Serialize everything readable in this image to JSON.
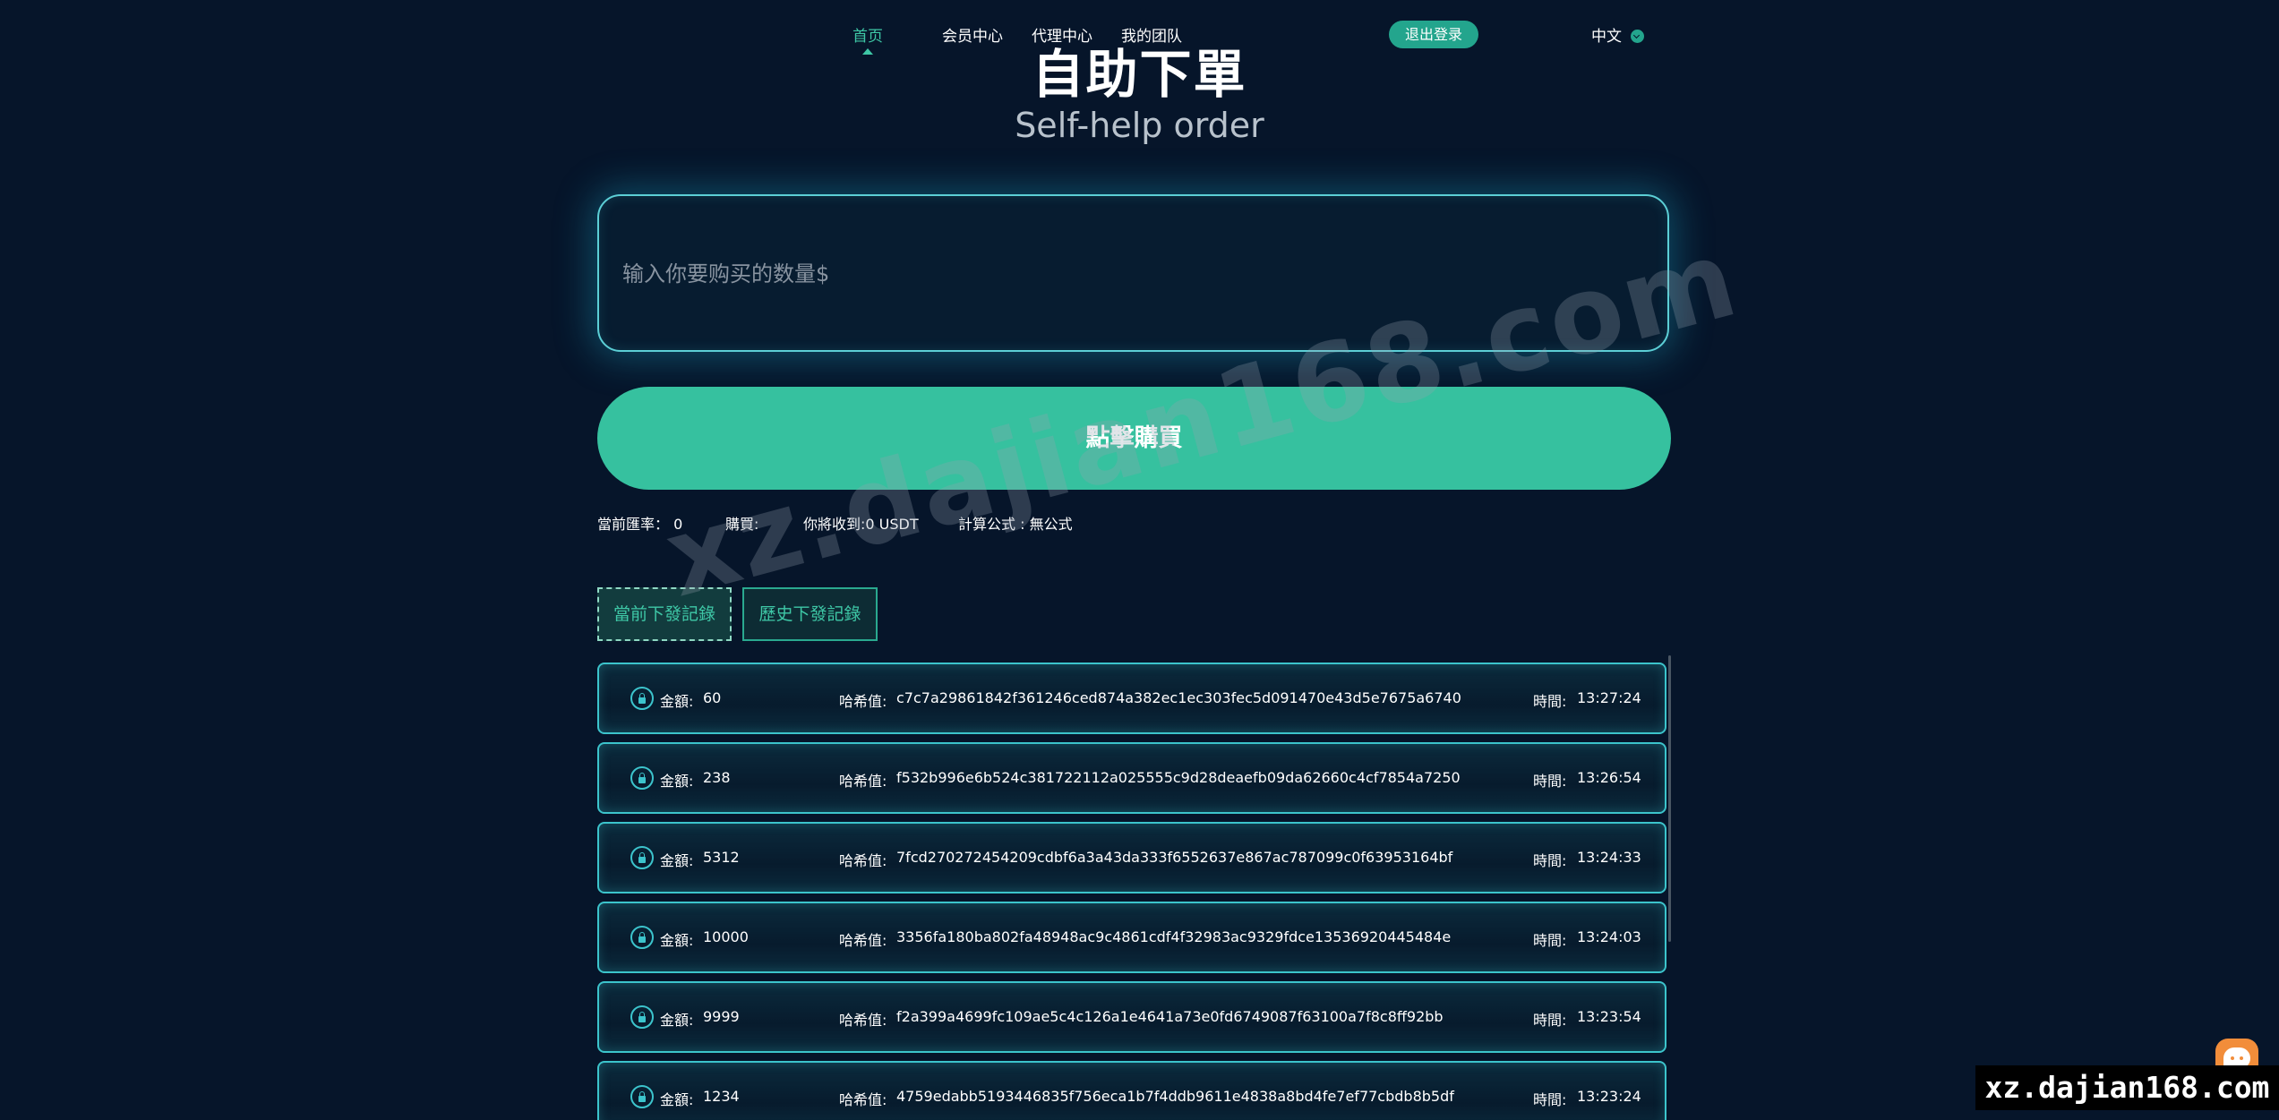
{
  "nav": {
    "home": "首页",
    "member": "会员中心",
    "agent": "代理中心",
    "team": "我的团队",
    "logout": "退出登录",
    "language": "中文"
  },
  "hero": {
    "title": "自助下單",
    "subtitle": "Self-help order"
  },
  "form": {
    "amount_placeholder": "输入你要购买的数量$",
    "buy_button": "點擊購買"
  },
  "info": {
    "rate": "當前匯率： 0",
    "purchase": "購買:",
    "receive": "你將收到:0 USDT",
    "formula": "計算公式 : 無公式"
  },
  "tabs": {
    "current": "當前下發記錄",
    "history": "歷史下發記錄"
  },
  "records": [
    {
      "amount_label": "金額:",
      "amount": "60",
      "hash_label": "哈希值:",
      "hash": "c7c7a29861842f361246ced874a382ec1ec303fec5d091470e43d5e7675a6740",
      "time_label": "時間:",
      "time": "13:27:24"
    },
    {
      "amount_label": "金額:",
      "amount": "238",
      "hash_label": "哈希值:",
      "hash": "f532b996e6b524c381722112a025555c9d28deaefb09da62660c4cf7854a7250",
      "time_label": "時間:",
      "time": "13:26:54"
    },
    {
      "amount_label": "金額:",
      "amount": "5312",
      "hash_label": "哈希值:",
      "hash": "7fcd270272454209cdbf6a3a43da333f6552637e867ac787099c0f63953164bf",
      "time_label": "時間:",
      "time": "13:24:33"
    },
    {
      "amount_label": "金額:",
      "amount": "10000",
      "hash_label": "哈希值:",
      "hash": "3356fa180ba802fa48948ac9c4861cdf4f32983ac9329fdce13536920445484e",
      "time_label": "時間:",
      "time": "13:24:03"
    },
    {
      "amount_label": "金額:",
      "amount": "9999",
      "hash_label": "哈希值:",
      "hash": "f2a399a4699fc109ae5c4c126a1e4641a73e0fd6749087f63100a7f8c8ff92bb",
      "time_label": "時間:",
      "time": "13:23:54"
    },
    {
      "amount_label": "金額:",
      "amount": "1234",
      "hash_label": "哈希值:",
      "hash": "4759edabb5193446835f756eca1b7f4ddb9611e4838a8bd4fe7ef77cbdb8b5df",
      "time_label": "時間:",
      "time": "13:23:24"
    }
  ],
  "watermark": {
    "diagonal": "xz.dajian168.com",
    "corner": "xz.dajian168.com"
  },
  "colors": {
    "background": "#06152a",
    "accent": "#36c19f",
    "border_glow": "#3cc4cc"
  }
}
